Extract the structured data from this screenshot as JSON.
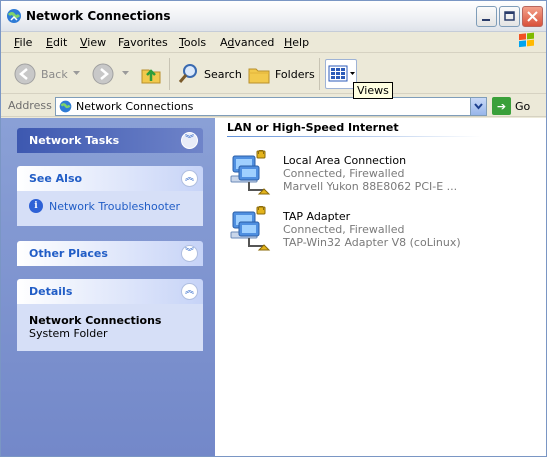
{
  "window": {
    "title": "Network Connections"
  },
  "menu": [
    "File",
    "Edit",
    "View",
    "Favorites",
    "Tools",
    "Advanced",
    "Help"
  ],
  "menu_underline": [
    "F",
    "E",
    "V",
    "a",
    "T",
    "d",
    "H"
  ],
  "toolbar": {
    "back_label": "Back",
    "search_label": "Search",
    "folders_label": "Folders",
    "views_tooltip": "Views"
  },
  "address": {
    "label": "Address",
    "value": "Network Connections",
    "go_label": "Go"
  },
  "left_pane": {
    "network_tasks": {
      "title": "Network Tasks"
    },
    "see_also": {
      "title": "See Also",
      "items": [
        "Network Troubleshooter"
      ]
    },
    "other_places": {
      "title": "Other Places"
    },
    "details": {
      "title": "Details",
      "name": "Network Connections",
      "type": "System Folder"
    }
  },
  "content": {
    "group_title": "LAN or High-Speed Internet",
    "connections": [
      {
        "name": "Local Area Connection",
        "status": "Connected, Firewalled",
        "device": "Marvell Yukon 88E8062 PCI-E ..."
      },
      {
        "name": "TAP Adapter",
        "status": "Connected, Firewalled",
        "device": "TAP-Win32 Adapter V8 (coLinux)"
      }
    ]
  }
}
